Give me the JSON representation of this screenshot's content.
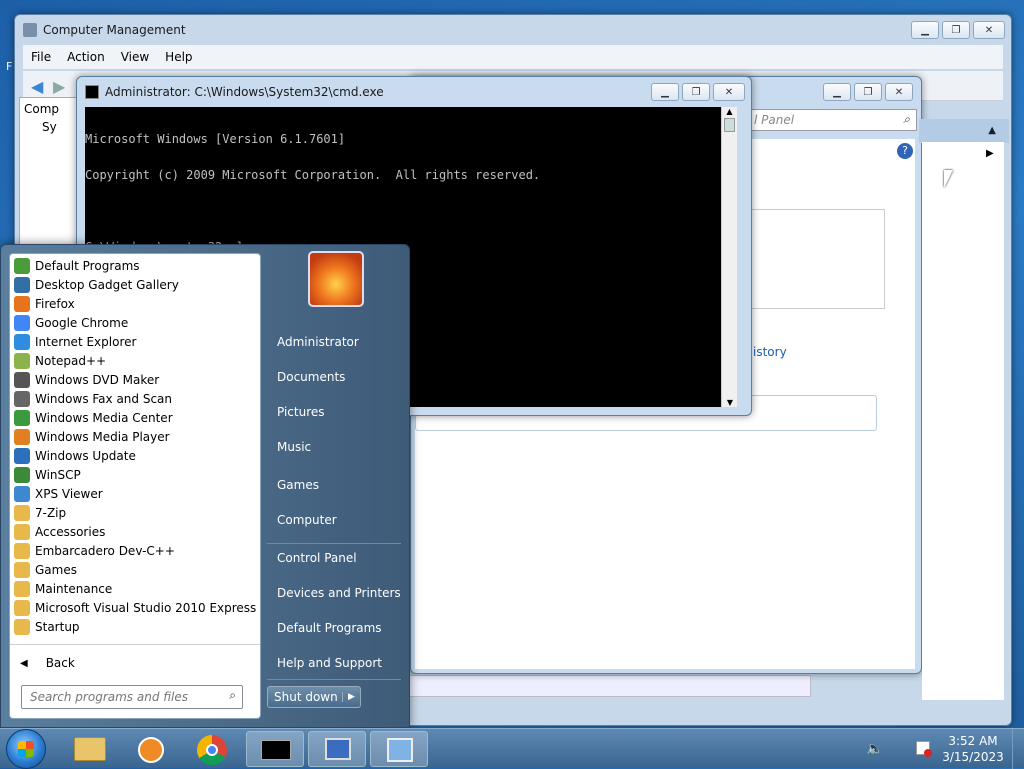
{
  "computer_management": {
    "title": "Computer Management",
    "menu": [
      "File",
      "Action",
      "View",
      "Help"
    ],
    "tree_items": [
      "Comp",
      "Sy"
    ]
  },
  "second_window": {
    "search_placeholder": "l Panel",
    "link": "istory"
  },
  "cmd": {
    "title": "Administrator: C:\\Windows\\System32\\cmd.exe",
    "lines": [
      "Microsoft Windows [Version 6.1.7601]",
      "Copyright (c) 2009 Microsoft Corporation.  All rights reserved.",
      "",
      "C:\\Windows\\system32>slmgr",
      "",
      "C:\\Windows\\system32>"
    ]
  },
  "start_menu": {
    "programs": [
      "Default Programs",
      "Desktop Gadget Gallery",
      "Firefox",
      "Google Chrome",
      "Internet Explorer",
      "Notepad++",
      "Windows DVD Maker",
      "Windows Fax and Scan",
      "Windows Media Center",
      "Windows Media Player",
      "Windows Update",
      "WinSCP",
      "XPS Viewer",
      "7-Zip",
      "Accessories",
      "Embarcadero Dev-C++",
      "Games",
      "Maintenance",
      "Microsoft Visual Studio 2010 Express",
      "Startup"
    ],
    "back": "Back",
    "search_placeholder": "Search programs and files",
    "right": [
      "Administrator",
      "Documents",
      "Pictures",
      "Music",
      "Games",
      "Computer",
      "Control Panel",
      "Devices and Printers",
      "Default Programs",
      "Help and Support"
    ],
    "shutdown": "Shut down"
  },
  "clock": {
    "time": "3:52 AM",
    "date": "3/15/2023"
  },
  "colors": {
    "folder": "#e8b84a",
    "accent": "#3e5b78"
  }
}
